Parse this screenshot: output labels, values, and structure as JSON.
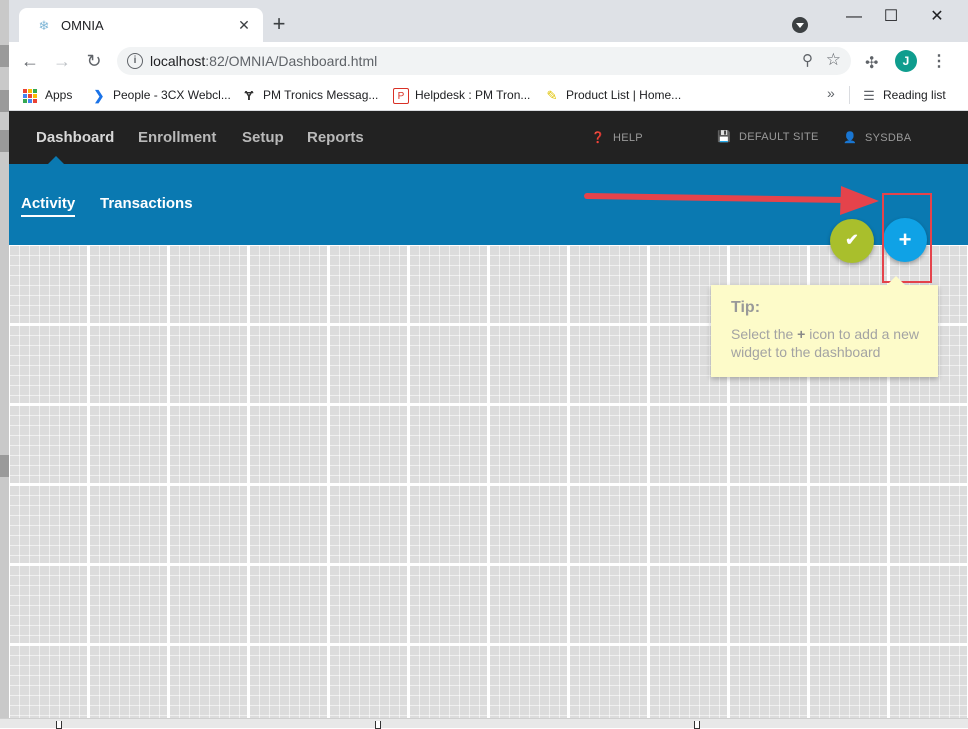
{
  "browser": {
    "tab_title": "OMNIA",
    "new_tab": "+",
    "window_controls": {
      "minimize": "—",
      "maximize": "☐",
      "close": "✕"
    },
    "url_host": "localhost",
    "url_rest": ":82/OMNIA/Dashboard.html",
    "profile_initial": "J",
    "bookmarks": [
      {
        "label": "Apps",
        "icon": "apps-grid-icon"
      },
      {
        "label": "People - 3CX Webcl...",
        "icon": "3cx-chevron-icon"
      },
      {
        "label": "PM Tronics Messag...",
        "icon": "pm-tronics-icon"
      },
      {
        "label": "Helpdesk : PM Tron...",
        "icon": "helpdesk-icon"
      },
      {
        "label": "Product List | Home...",
        "icon": "notepad-icon"
      }
    ],
    "bookmarks_more": "»",
    "reading_list": "Reading list"
  },
  "app": {
    "nav": [
      "Dashboard",
      "Enrollment",
      "Setup",
      "Reports"
    ],
    "help": "HELP",
    "site": "DEFAULT SITE",
    "user": "SYSDBA",
    "tabs": [
      "Activity",
      "Transactions"
    ],
    "fab_check": "✔",
    "fab_add": "+"
  },
  "tip": {
    "title": "Tip:",
    "text_before": "Select the ",
    "text_bold": "+",
    "text_after": " icon to add a new widget to the dashboard"
  },
  "colors": {
    "nav_bg": "#222222",
    "subnav_bg": "#0a79b1",
    "fab_check": "#a9bf2c",
    "fab_add": "#0fa2e6",
    "annotation": "#e5434b",
    "tip_bg": "#fdfbc9"
  }
}
